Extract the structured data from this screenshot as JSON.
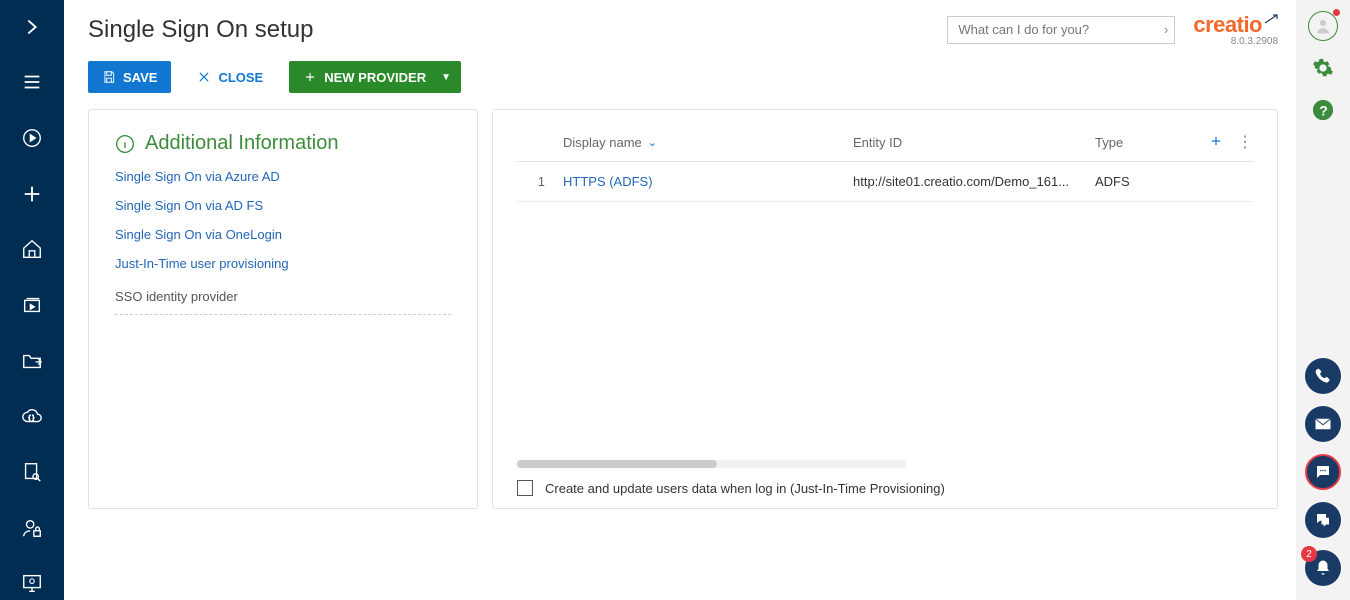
{
  "page": {
    "title": "Single Sign On setup"
  },
  "search": {
    "placeholder": "What can I do for you?"
  },
  "brand": {
    "name": "creatio",
    "version": "8.0.3.2908"
  },
  "actions": {
    "save": "SAVE",
    "close": "CLOSE",
    "new_provider": "NEW PROVIDER"
  },
  "info_panel": {
    "heading": "Additional Information",
    "links": [
      "Single Sign On via Azure AD",
      "Single Sign On via AD FS",
      "Single Sign On via OneLogin",
      "Just-In-Time user provisioning"
    ],
    "footer_text": "SSO identity provider"
  },
  "grid": {
    "columns": {
      "display_name": "Display name",
      "entity_id": "Entity ID",
      "type": "Type"
    },
    "rows": [
      {
        "num": "1",
        "display_name": "HTTPS (ADFS)",
        "entity_id": "http://site01.creatio.com/Demo_161...",
        "type": "ADFS"
      }
    ],
    "jit_label": "Create and update users data when log in (Just-In-Time Provisioning)"
  },
  "rail": {
    "notif_count": "2"
  }
}
